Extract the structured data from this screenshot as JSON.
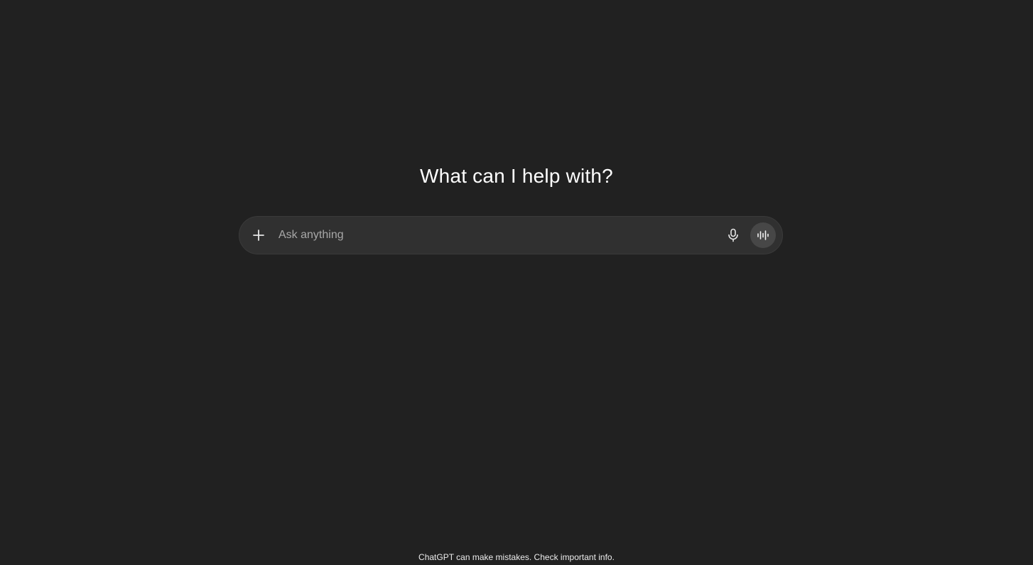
{
  "hero": {
    "title": "What can I help with?"
  },
  "composer": {
    "placeholder": "Ask anything",
    "value": "",
    "icons": {
      "attach": "plus-icon",
      "dictate": "microphone-icon",
      "voice": "voice-waveform-icon"
    }
  },
  "footer": {
    "disclaimer": "ChatGPT can make mistakes. Check important info."
  },
  "colors": {
    "background": "#212121",
    "composer": "#303030",
    "voice_button": "#474747",
    "text": "#ececec"
  }
}
